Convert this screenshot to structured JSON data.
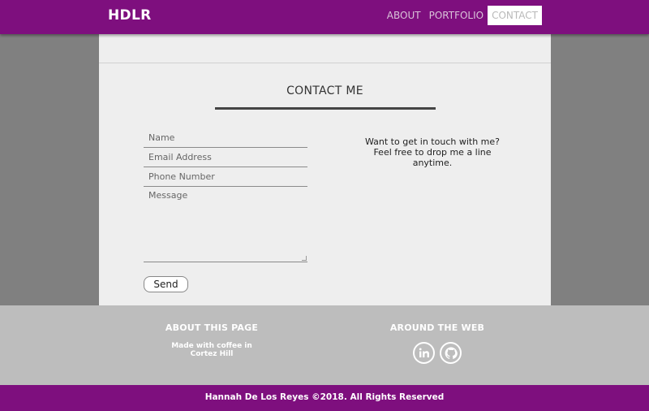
{
  "brand": "HDLR",
  "nav": {
    "items": [
      {
        "label": "ABOUT"
      },
      {
        "label": "PORTFOLIO"
      },
      {
        "label": "CONTACT"
      }
    ],
    "active": "CONTACT"
  },
  "contact": {
    "title": "CONTACT ME",
    "fields": {
      "name_placeholder": "Name",
      "email_placeholder": "Email Address",
      "phone_placeholder": "Phone Number",
      "message_placeholder": "Message"
    },
    "send_label": "Send",
    "intro_line1": "Want to get in touch with me?",
    "intro_line2": "Feel free to drop me a line",
    "intro_line3": "anytime."
  },
  "footer": {
    "about_heading": "ABOUT THIS PAGE",
    "about_line1": "Made with coffee in",
    "about_line2": "Cortez Hill",
    "web_heading": "AROUND THE WEB",
    "social_icons": [
      "linkedin-icon",
      "github-icon"
    ],
    "copyright": "Hannah De Los Reyes ©2018. All Rights Reserved"
  },
  "colors": {
    "brand_purple": "#7e0f7e",
    "page_background": "#808080",
    "card_background": "#eeeeee",
    "footer_background": "#bdbdbd"
  }
}
